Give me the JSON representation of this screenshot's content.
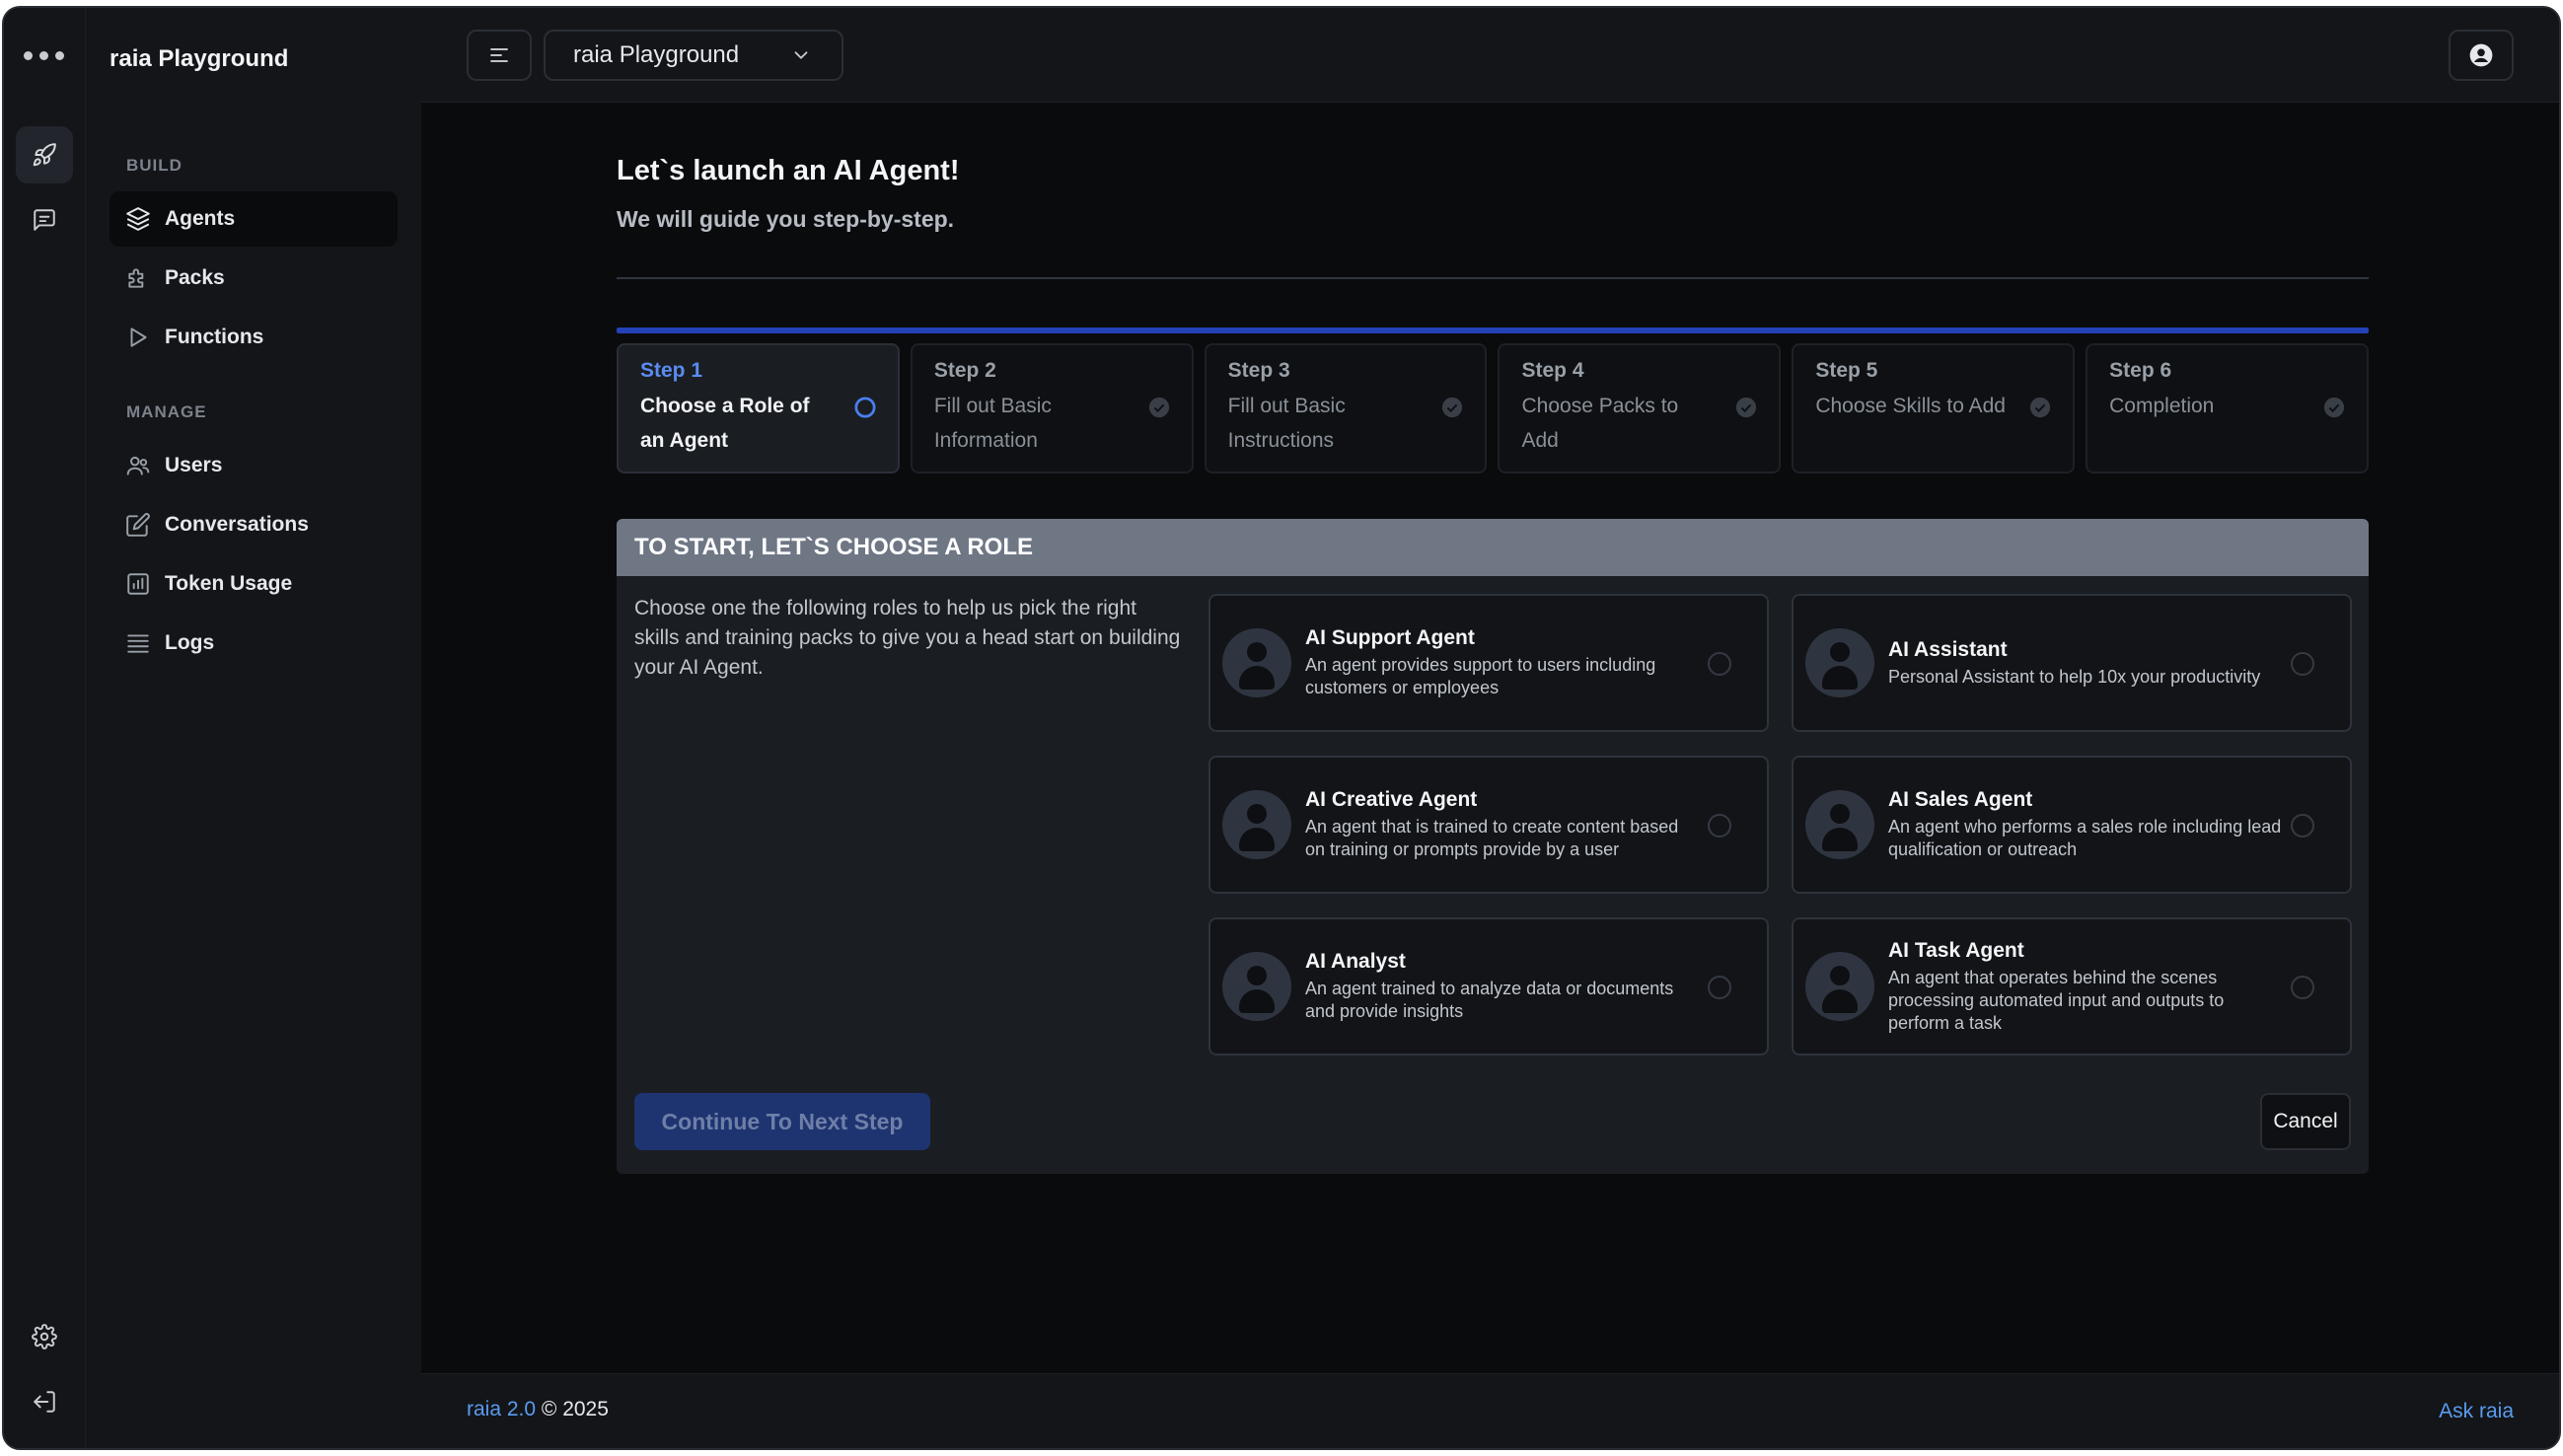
{
  "app": {
    "brand": "raia Playground",
    "workspace": "raia Playground"
  },
  "sidebar": {
    "sections": [
      {
        "title": "BUILD",
        "items": [
          {
            "label": "Agents",
            "icon": "layers-icon",
            "active": true
          },
          {
            "label": "Packs",
            "icon": "puzzle-icon"
          },
          {
            "label": "Functions",
            "icon": "play-icon"
          }
        ]
      },
      {
        "title": "MANAGE",
        "items": [
          {
            "label": "Users",
            "icon": "users-icon"
          },
          {
            "label": "Conversations",
            "icon": "edit-icon"
          },
          {
            "label": "Token Usage",
            "icon": "chart-icon"
          },
          {
            "label": "Logs",
            "icon": "list-icon"
          }
        ]
      }
    ]
  },
  "main": {
    "title": "Let`s launch an AI Agent!",
    "subtitle": "We will guide you step-by-step.",
    "steps": [
      {
        "number": "Step 1",
        "description": "Choose a Role of an Agent",
        "active": true
      },
      {
        "number": "Step 2",
        "description": "Fill out Basic Information"
      },
      {
        "number": "Step 3",
        "description": "Fill out Basic Instructions"
      },
      {
        "number": "Step 4",
        "description": "Choose Packs to Add"
      },
      {
        "number": "Step 5",
        "description": "Choose Skills to Add"
      },
      {
        "number": "Step 6",
        "description": "Completion"
      }
    ],
    "panel": {
      "heading": "TO START, LET`S CHOOSE A ROLE",
      "intro": "Choose one the following roles to help us pick the right skills and training packs to give you a head start on building your AI Agent.",
      "roles": [
        {
          "title": "AI Support Agent",
          "description": "An agent provides support to users including customers or employees"
        },
        {
          "title": "AI Assistant",
          "description": "Personal Assistant to help 10x your productivity"
        },
        {
          "title": "AI Creative Agent",
          "description": "An agent that is trained to create content based on training or prompts provide by a user"
        },
        {
          "title": "AI Sales Agent",
          "description": "An agent who performs a sales role including lead qualification or outreach"
        },
        {
          "title": "AI Analyst",
          "description": "An agent trained to analyze data or documents and provide insights"
        },
        {
          "title": "AI Task Agent",
          "description": "An agent that operates behind the scenes processing automated input and outputs to perform a task"
        }
      ],
      "continue_label": "Continue To Next Step",
      "cancel_label": "Cancel"
    }
  },
  "footer": {
    "version": "raia 2.0",
    "copyright": "© 2025",
    "ask": "Ask raia"
  },
  "colors": {
    "accent": "#2242b6",
    "link": "#5a9cf0",
    "background": "#0a0b0d",
    "surface": "#131519"
  }
}
